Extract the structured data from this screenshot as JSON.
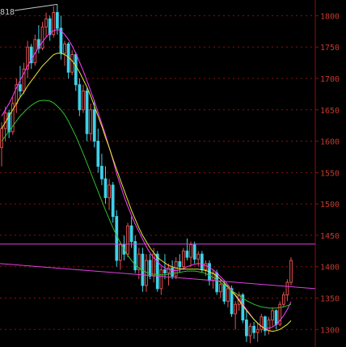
{
  "colors": {
    "background": "#000000",
    "grid": "#8a1010",
    "axis": "#8a1010",
    "tick_text": "#c43a2a",
    "candle_up": "#e05050",
    "candle_down": "#40d0e8",
    "ma_short": "#ff40ff",
    "ma_mid": "#e8e830",
    "ma_long": "#30c030",
    "line_horizontal": "#e040e0",
    "line_trend": "#e040e0",
    "annotation": "#c8c8c8"
  },
  "chart_data": {
    "type": "candlestick",
    "title": "",
    "xlabel": "",
    "ylabel": "",
    "ylim": [
      1272,
      1825
    ],
    "grid": true,
    "yticks": [
      "1300",
      "1350",
      "1400",
      "1450",
      "1500",
      "1550",
      "1600",
      "1650",
      "1700",
      "1750",
      "1800"
    ],
    "candles": [
      [
        1590,
        1630,
        1560,
        1620
      ],
      [
        1620,
        1655,
        1600,
        1645
      ],
      [
        1645,
        1650,
        1605,
        1615
      ],
      [
        1615,
        1670,
        1610,
        1660
      ],
      [
        1660,
        1700,
        1645,
        1690
      ],
      [
        1690,
        1720,
        1670,
        1680
      ],
      [
        1680,
        1725,
        1675,
        1715
      ],
      [
        1715,
        1760,
        1700,
        1750
      ],
      [
        1750,
        1755,
        1715,
        1725
      ],
      [
        1725,
        1770,
        1720,
        1762
      ],
      [
        1762,
        1785,
        1740,
        1748
      ],
      [
        1748,
        1790,
        1745,
        1782
      ],
      [
        1782,
        1805,
        1765,
        1795
      ],
      [
        1795,
        1800,
        1760,
        1770
      ],
      [
        1770,
        1815,
        1765,
        1805
      ],
      [
        1805,
        1818,
        1770,
        1780
      ],
      [
        1780,
        1800,
        1730,
        1740
      ],
      [
        1740,
        1760,
        1720,
        1755
      ],
      [
        1755,
        1758,
        1700,
        1710
      ],
      [
        1710,
        1745,
        1705,
        1738
      ],
      [
        1738,
        1742,
        1680,
        1690
      ],
      [
        1690,
        1700,
        1640,
        1650
      ],
      [
        1650,
        1690,
        1645,
        1680
      ],
      [
        1680,
        1685,
        1600,
        1612
      ],
      [
        1612,
        1660,
        1600,
        1650
      ],
      [
        1650,
        1665,
        1590,
        1600
      ],
      [
        1600,
        1620,
        1550,
        1560
      ],
      [
        1560,
        1580,
        1530,
        1540
      ],
      [
        1540,
        1560,
        1500,
        1510
      ],
      [
        1510,
        1540,
        1490,
        1530
      ],
      [
        1530,
        1535,
        1470,
        1480
      ],
      [
        1480,
        1490,
        1400,
        1410
      ],
      [
        1410,
        1440,
        1395,
        1435
      ],
      [
        1435,
        1450,
        1410,
        1420
      ],
      [
        1420,
        1470,
        1415,
        1465
      ],
      [
        1465,
        1480,
        1430,
        1440
      ],
      [
        1440,
        1450,
        1390,
        1395
      ],
      [
        1395,
        1430,
        1380,
        1420
      ],
      [
        1420,
        1430,
        1360,
        1370
      ],
      [
        1370,
        1420,
        1360,
        1410
      ],
      [
        1410,
        1420,
        1380,
        1385
      ],
      [
        1385,
        1430,
        1375,
        1420
      ],
      [
        1420,
        1425,
        1360,
        1365
      ],
      [
        1365,
        1400,
        1355,
        1395
      ],
      [
        1395,
        1420,
        1380,
        1390
      ],
      [
        1390,
        1405,
        1370,
        1398
      ],
      [
        1398,
        1410,
        1380,
        1385
      ],
      [
        1385,
        1415,
        1380,
        1408
      ],
      [
        1408,
        1420,
        1390,
        1400
      ],
      [
        1400,
        1430,
        1395,
        1425
      ],
      [
        1425,
        1445,
        1410,
        1415
      ],
      [
        1415,
        1440,
        1400,
        1435
      ],
      [
        1435,
        1440,
        1405,
        1412
      ],
      [
        1412,
        1425,
        1400,
        1420
      ],
      [
        1420,
        1425,
        1390,
        1395
      ],
      [
        1395,
        1410,
        1385,
        1405
      ],
      [
        1405,
        1410,
        1370,
        1378
      ],
      [
        1378,
        1395,
        1365,
        1390
      ],
      [
        1390,
        1395,
        1355,
        1360
      ],
      [
        1360,
        1380,
        1350,
        1372
      ],
      [
        1372,
        1378,
        1340,
        1345
      ],
      [
        1345,
        1370,
        1335,
        1365
      ],
      [
        1365,
        1370,
        1320,
        1325
      ],
      [
        1325,
        1345,
        1300,
        1340
      ],
      [
        1340,
        1360,
        1330,
        1355
      ],
      [
        1355,
        1358,
        1310,
        1315
      ],
      [
        1315,
        1330,
        1280,
        1290
      ],
      [
        1290,
        1310,
        1278,
        1305
      ],
      [
        1305,
        1312,
        1285,
        1295
      ],
      [
        1295,
        1310,
        1280,
        1300
      ],
      [
        1300,
        1325,
        1295,
        1320
      ],
      [
        1320,
        1322,
        1290,
        1298
      ],
      [
        1298,
        1320,
        1292,
        1315
      ],
      [
        1315,
        1335,
        1305,
        1330
      ],
      [
        1330,
        1332,
        1300,
        1308
      ],
      [
        1308,
        1345,
        1305,
        1340
      ],
      [
        1340,
        1360,
        1335,
        1355
      ],
      [
        1355,
        1380,
        1345,
        1375
      ],
      [
        1375,
        1415,
        1370,
        1410
      ]
    ],
    "series": [
      {
        "values": [
          1640,
          1650,
          1660,
          1672,
          1685,
          1697,
          1708,
          1720,
          1730,
          1740,
          1750,
          1758,
          1766,
          1772,
          1776,
          1778,
          1776,
          1770,
          1762,
          1752,
          1740,
          1726,
          1712,
          1696,
          1680,
          1664,
          1646,
          1628,
          1610,
          1590,
          1570,
          1548,
          1530,
          1512,
          1496,
          1482,
          1468,
          1456,
          1444,
          1432,
          1422,
          1414,
          1408,
          1402,
          1398,
          1396,
          1394,
          1394,
          1395,
          1397,
          1400,
          1402,
          1404,
          1405,
          1404,
          1402,
          1399,
          1395,
          1390,
          1384,
          1378,
          1371,
          1363,
          1355,
          1348,
          1340,
          1332,
          1324,
          1316,
          1310,
          1305,
          1302,
          1302,
          1304,
          1308,
          1314,
          1322,
          1332,
          1344
        ]
      },
      {
        "values": [
          1620,
          1630,
          1640,
          1650,
          1660,
          1670,
          1678,
          1688,
          1696,
          1704,
          1712,
          1720,
          1726,
          1732,
          1738,
          1740,
          1740,
          1738,
          1734,
          1728,
          1720,
          1710,
          1698,
          1686,
          1672,
          1656,
          1640,
          1624,
          1606,
          1590,
          1572,
          1555,
          1538,
          1522,
          1506,
          1490,
          1476,
          1462,
          1450,
          1440,
          1430,
          1422,
          1415,
          1410,
          1406,
          1402,
          1400,
          1398,
          1397,
          1396,
          1396,
          1396,
          1396,
          1396,
          1395,
          1394,
          1392,
          1389,
          1385,
          1380,
          1374,
          1368,
          1361,
          1354,
          1346,
          1338,
          1330,
          1323,
          1316,
          1310,
          1305,
          1301,
          1298,
          1297,
          1298,
          1300,
          1304,
          1308,
          1314
        ]
      },
      {
        "values": [
          1600,
          1608,
          1616,
          1624,
          1632,
          1640,
          1646,
          1652,
          1657,
          1661,
          1664,
          1665,
          1665,
          1664,
          1661,
          1656,
          1650,
          1642,
          1632,
          1620,
          1608,
          1594,
          1580,
          1565,
          1550,
          1535,
          1520,
          1505,
          1490,
          1476,
          1462,
          1450,
          1438,
          1428,
          1418,
          1410,
          1403,
          1398,
          1394,
          1391,
          1389,
          1388,
          1387,
          1387,
          1387,
          1388,
          1389,
          1390,
          1391,
          1392,
          1393,
          1393,
          1393,
          1392,
          1391,
          1389,
          1386,
          1383,
          1379,
          1375,
          1371,
          1367,
          1362,
          1358,
          1354,
          1350,
          1346,
          1343,
          1340,
          1338,
          1336,
          1335,
          1334,
          1334,
          1334,
          1335,
          1336,
          1338,
          1340
        ]
      }
    ],
    "lines": [
      {
        "kind": "horizontal",
        "y": 1436
      },
      {
        "kind": "trend",
        "y_start": 1405,
        "y_end": 1365
      }
    ],
    "annotations": [
      {
        "text": "818",
        "kind": "peak-label",
        "y": 1818
      }
    ]
  }
}
